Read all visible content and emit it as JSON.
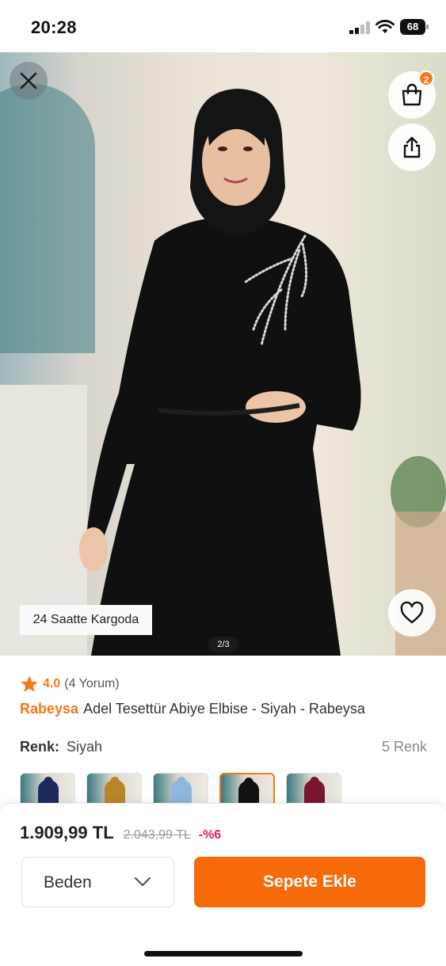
{
  "status_bar": {
    "time": "20:28",
    "battery": "68"
  },
  "product_image": {
    "shipping_badge": "24 Saatte Kargoda",
    "image_counter": "2/3",
    "cart_count": "2",
    "icons": {
      "close": "close-icon",
      "cart": "shopping-bag-icon",
      "share": "share-icon",
      "favorite": "heart-icon"
    }
  },
  "product": {
    "rating": "4.0",
    "review_count": "(4 Yorum)",
    "brand": "Rabeysa",
    "name": "Adel Tesettür Abiye Elbise - Siyah - Rabeysa",
    "color_label": "Renk:",
    "color_value": "Siyah",
    "color_count": "5 Renk",
    "swatches": [
      {
        "color": "navy",
        "dress": "#1f2a5c",
        "selected": false
      },
      {
        "color": "mustard",
        "dress": "#b8862a",
        "selected": false
      },
      {
        "color": "light-blue",
        "dress": "#8fb6dc",
        "selected": false
      },
      {
        "color": "black",
        "dress": "#121212",
        "selected": true
      },
      {
        "color": "burgundy",
        "dress": "#7a1530",
        "selected": false
      }
    ]
  },
  "purchase": {
    "price": "1.909,99 TL",
    "old_price": "2.043,99 TL",
    "discount": "-%6",
    "size_label": "Beden",
    "add_to_cart": "Sepete Ekle"
  },
  "colors": {
    "accent": "#f27a1a",
    "button": "#f66a0a",
    "discount": "#d91f5f"
  }
}
